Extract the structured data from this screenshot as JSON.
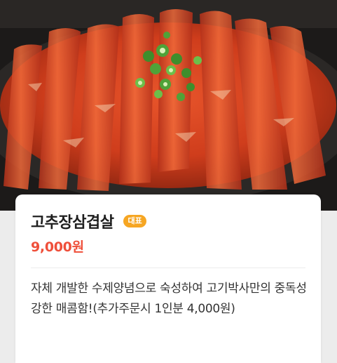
{
  "menu": {
    "name": "고추장삼겹살",
    "badge": "대표",
    "price": "9,000원",
    "description": "자체 개발한 수제양념으로 숙성하여 고기박사만의 중독성 강한 매콤함!(추가주문시 1인분 4,000원)"
  },
  "colors": {
    "price": "#ef4f3a",
    "badge_bg": "#f6a623",
    "title": "#1e1e1e",
    "description": "#333333"
  }
}
